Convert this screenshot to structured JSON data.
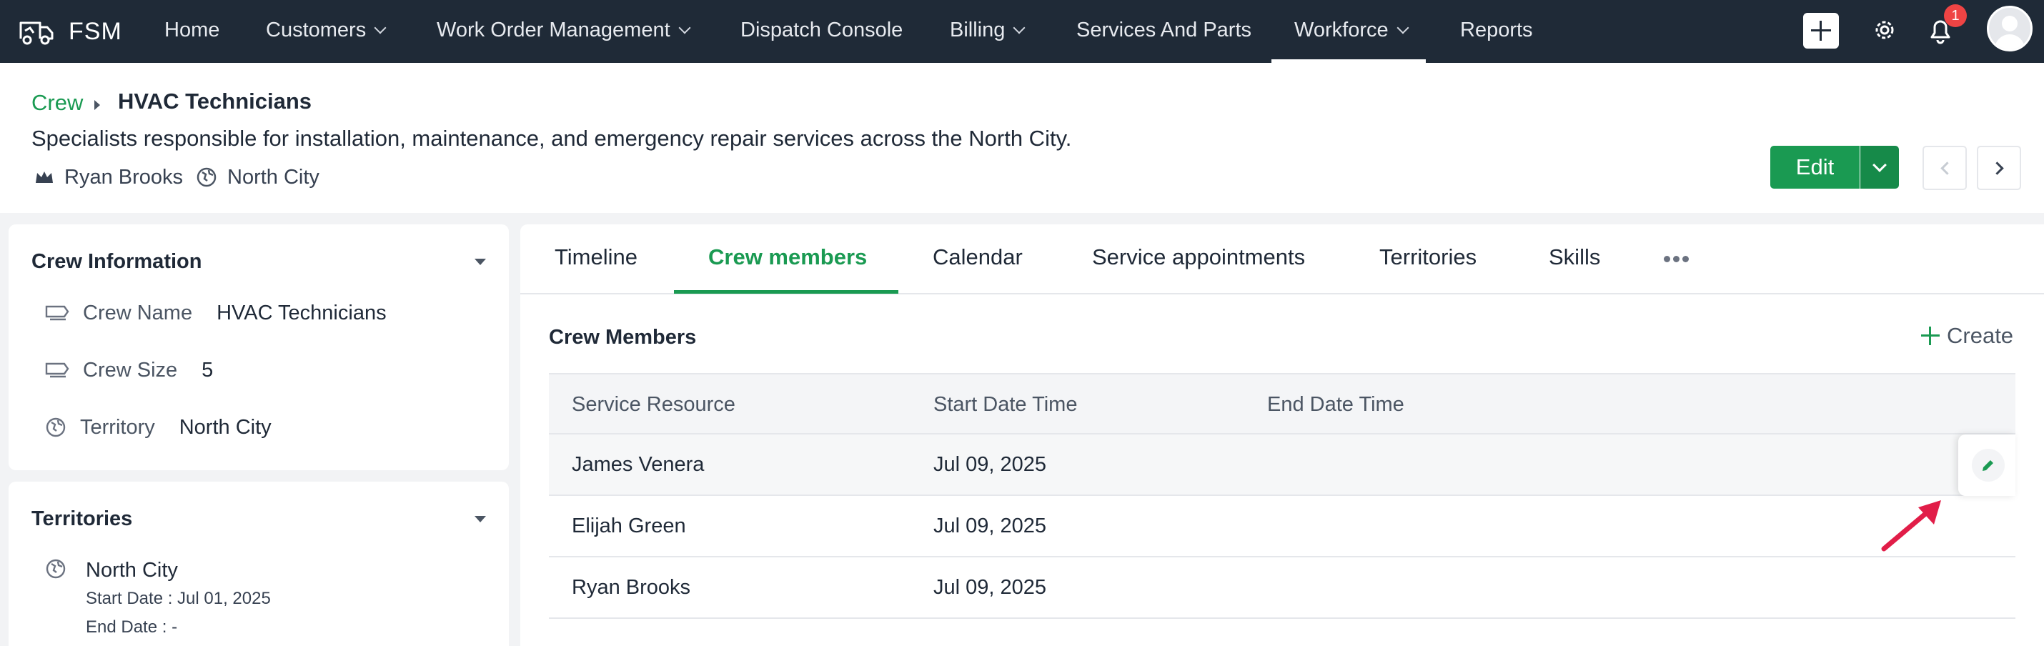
{
  "app": {
    "name": "FSM"
  },
  "nav": {
    "items": [
      {
        "label": "Home",
        "has_menu": false
      },
      {
        "label": "Customers",
        "has_menu": true
      },
      {
        "label": "Work Order Management",
        "has_menu": true
      },
      {
        "label": "Dispatch Console",
        "has_menu": false
      },
      {
        "label": "Billing",
        "has_menu": true
      },
      {
        "label": "Services And Parts",
        "has_menu": false
      },
      {
        "label": "Workforce",
        "has_menu": true,
        "active": true
      },
      {
        "label": "Reports",
        "has_menu": false
      }
    ],
    "notification_count": "1",
    "icons": [
      "plus-icon",
      "gear-icon",
      "bell-icon",
      "avatar"
    ]
  },
  "header": {
    "breadcrumb_link": "Crew",
    "title": "HVAC Technicians",
    "description": "Specialists responsible for installation, maintenance, and emergency repair services across the North City.",
    "owner": "Ryan Brooks",
    "territory": "North City",
    "edit_label": "Edit"
  },
  "crew_info": {
    "title": "Crew Information",
    "fields": [
      {
        "label": "Crew Name",
        "value": "HVAC Technicians"
      },
      {
        "label": "Crew Size",
        "value": "5"
      },
      {
        "label": "Territory",
        "value": "North City"
      }
    ]
  },
  "territories": {
    "title": "Territories",
    "items": [
      {
        "name": "North City",
        "start": "Start Date : Jul 01, 2025",
        "end": "End Date : -"
      }
    ]
  },
  "tabs": [
    {
      "label": "Timeline"
    },
    {
      "label": "Crew members",
      "active": true
    },
    {
      "label": "Calendar"
    },
    {
      "label": "Service appointments"
    },
    {
      "label": "Territories"
    },
    {
      "label": "Skills"
    }
  ],
  "crew_members": {
    "title": "Crew Members",
    "create_label": "Create",
    "columns": [
      "Service Resource",
      "Start Date Time",
      "End Date Time"
    ],
    "rows": [
      {
        "resource": "James Venera",
        "start": "Jul 09, 2025",
        "end": ""
      },
      {
        "resource": "Elijah Green",
        "start": "Jul 09, 2025",
        "end": ""
      },
      {
        "resource": "Ryan Brooks",
        "start": "Jul 09, 2025",
        "end": ""
      }
    ]
  },
  "colors": {
    "nav_bg": "#1f2a37",
    "accent": "#1a9a52",
    "annotation": "#e11d48"
  }
}
